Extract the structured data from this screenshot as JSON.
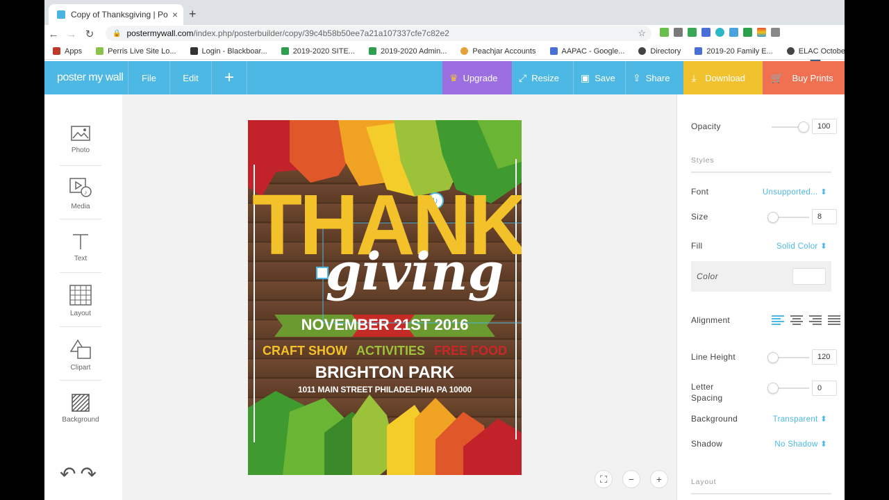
{
  "browser": {
    "tab_title": "Copy of Thanksgiving | PosterM",
    "tab_close": "×",
    "new_tab": "+",
    "url_host": "postermywall.com",
    "url_path": "/index.php/posterbuilder/copy/39c4b58b50ee7a21a107337cfe7c82e2",
    "bookmarks": [
      {
        "label": "Apps",
        "color": "#c0392b"
      },
      {
        "label": "Perris Live Site Lo...",
        "color": "#8bc34a"
      },
      {
        "label": "Login - Blackboar...",
        "color": "#333333"
      },
      {
        "label": "2019-2020 SITE...",
        "color": "#2e9e4f"
      },
      {
        "label": "2019-2020 Admin...",
        "color": "#2e9e4f"
      },
      {
        "label": "Peachjar Accounts",
        "color": "#e6a13a"
      },
      {
        "label": "AAPAC - Google...",
        "color": "#4a6fd8"
      },
      {
        "label": "Directory",
        "color": "#444444"
      },
      {
        "label": "2019-20 Family E...",
        "color": "#4a6fd8"
      },
      {
        "label": "ELAC October",
        "color": "#444444"
      }
    ]
  },
  "header": {
    "logo": "poster my wall",
    "file": "File",
    "edit": "Edit",
    "add": "+",
    "upgrade": "Upgrade",
    "resize": "Resize",
    "save": "Save",
    "share": "Share",
    "download": "Download",
    "buy_prints": "Buy Prints",
    "colors": {
      "bar": "#4cb8e3",
      "upgrade": "#9b6fe0",
      "download": "#f2c12e",
      "buy": "#ef7152"
    }
  },
  "tools": [
    "Photo",
    "Media",
    "Text",
    "Layout",
    "Clipart",
    "Background"
  ],
  "poster": {
    "thanks": "THANKS",
    "giving": "giving",
    "date": "NOVEMBER 21ST 2016",
    "craft": "CRAFT SHOW",
    "activities": "ACTIVITIES",
    "food": "FREE FOOD",
    "park": "BRIGHTON PARK",
    "address": "1011 MAIN STREET PHILADELPHIA PA 10000"
  },
  "props": {
    "opacity_label": "Opacity",
    "opacity_value": "100",
    "opacity_level": 1.0,
    "styles_label": "Styles",
    "font_label": "Font",
    "font_value": "Unsupported...",
    "size_label": "Size",
    "size_value": "8",
    "size_level": 0.05,
    "fill_label": "Fill",
    "fill_value": "Solid Color",
    "color_label": "Color",
    "alignment_label": "Alignment",
    "lineheight_label": "Line Height",
    "lineheight_value": "120",
    "letterspacing_label": "Letter Spacing",
    "letterspacing_value": "0",
    "background_label": "Background",
    "background_value": "Transparent",
    "shadow_label": "Shadow",
    "shadow_value": "No Shadow",
    "layout_label": "Layout"
  }
}
